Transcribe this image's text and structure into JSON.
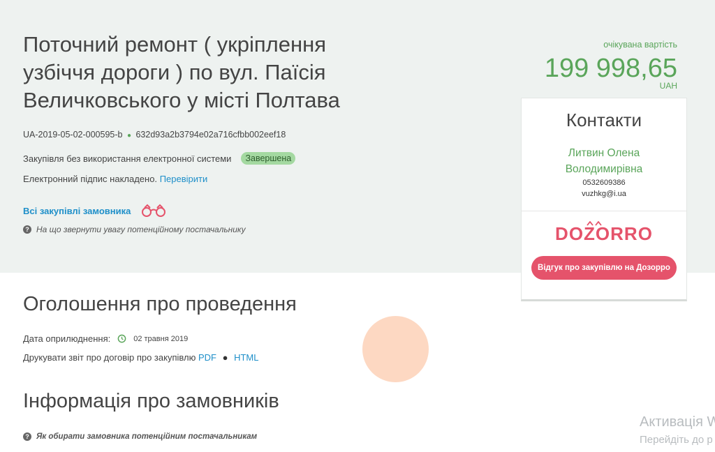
{
  "tender": {
    "title": "Поточний ремонт ( укріплення узбіччя дороги ) по вул. Паїсія Величковського у місті Полтава",
    "tender_id": "UA-2019-05-02-000595-b",
    "hash": "632d93a2b3794e02a716cfbb002eef18",
    "procedure": "Закупівля без використання електронної системи",
    "status": "Завершена",
    "signature_text": "Електронний підпис накладено.",
    "signature_link": "Перевірити",
    "all_purchases_link": "Всі закупівлі замовника",
    "attention_hint": "На що звернути увагу потенційному постачальнику"
  },
  "price": {
    "label": "очікувана вартість",
    "amount": "199 998,65",
    "currency": "UAH"
  },
  "contacts": {
    "title": "Контакти",
    "name_line1": "Литвин Олена",
    "name_line2": "Володимирівна",
    "phone": "0532609386",
    "email": "vuzhkg@i.ua",
    "dozorro_logo": "DOZORRO",
    "feedback_button": "Відгук про закупівлю на Дозорро"
  },
  "announcement": {
    "title": "Оголошення про проведення",
    "pub_label": "Дата оприлюднення:",
    "pub_date": "02 травня 2019",
    "print_label": "Друкувати звіт про договір про закупівлю",
    "print_pdf": "PDF",
    "print_sep": "●",
    "print_html": "HTML"
  },
  "customers": {
    "title": "Інформація про замовників",
    "hint": "Як обирати замовника потенційним постачальникам"
  },
  "activation": {
    "title": "Активація W",
    "text": "Перейдіть до р"
  },
  "icons": {
    "hash_dot": "green-dot-icon",
    "binoculars": "binoculars-icon",
    "help": "question-circle-icon",
    "clock": "clock-icon"
  },
  "colors": {
    "hero_bg": "#eef2f0",
    "accent_green": "#5aa55a",
    "status_badge": "#a4d9a1",
    "link_blue": "#1e8fc9",
    "dozorro_red": "#e5536b",
    "peach": "#fdd8c2"
  }
}
